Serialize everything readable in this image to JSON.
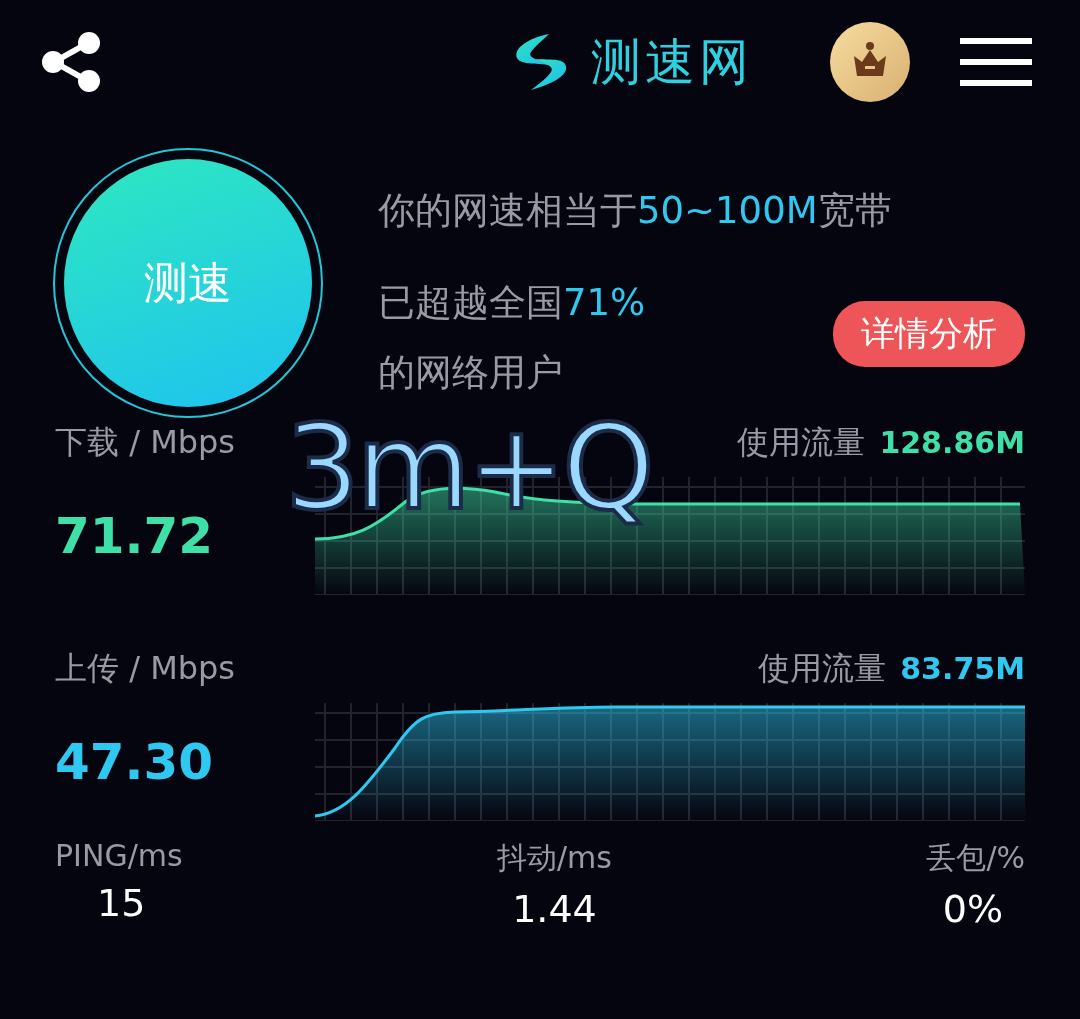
{
  "header": {
    "logo_text": "测速网"
  },
  "start_button": {
    "label": "测速"
  },
  "summary": [
    {
      "segments": [
        {
          "text": "你的网速相当于",
          "highlight": false
        },
        {
          "text": "50~100M",
          "highlight": true
        },
        {
          "text": "宽带",
          "highlight": false
        }
      ]
    },
    {
      "segments": [
        {
          "text": "已超越全国",
          "highlight": false
        },
        {
          "text": "71%",
          "highlight": true
        }
      ]
    },
    {
      "segments": [
        {
          "text": "的网络用户",
          "highlight": false
        }
      ]
    }
  ],
  "detail_button": {
    "label": "详情分析"
  },
  "annotation": "3m+Q",
  "speeds": [
    {
      "kind": "download",
      "label": "下载 / Mbps",
      "value": "71.72",
      "usage_label": "使用流量",
      "usage": "128.86M",
      "color": "#3ee0a8"
    },
    {
      "kind": "upload",
      "label": "上传 / Mbps",
      "value": "47.30",
      "usage_label": "使用流量",
      "usage": "83.75M",
      "color": "#2ec8f0"
    }
  ],
  "stats": [
    {
      "label": "PING/ms",
      "value": "15"
    },
    {
      "label": "抖动/ms",
      "value": "1.44"
    },
    {
      "label": "丢包/%",
      "value": "0%"
    }
  ]
}
